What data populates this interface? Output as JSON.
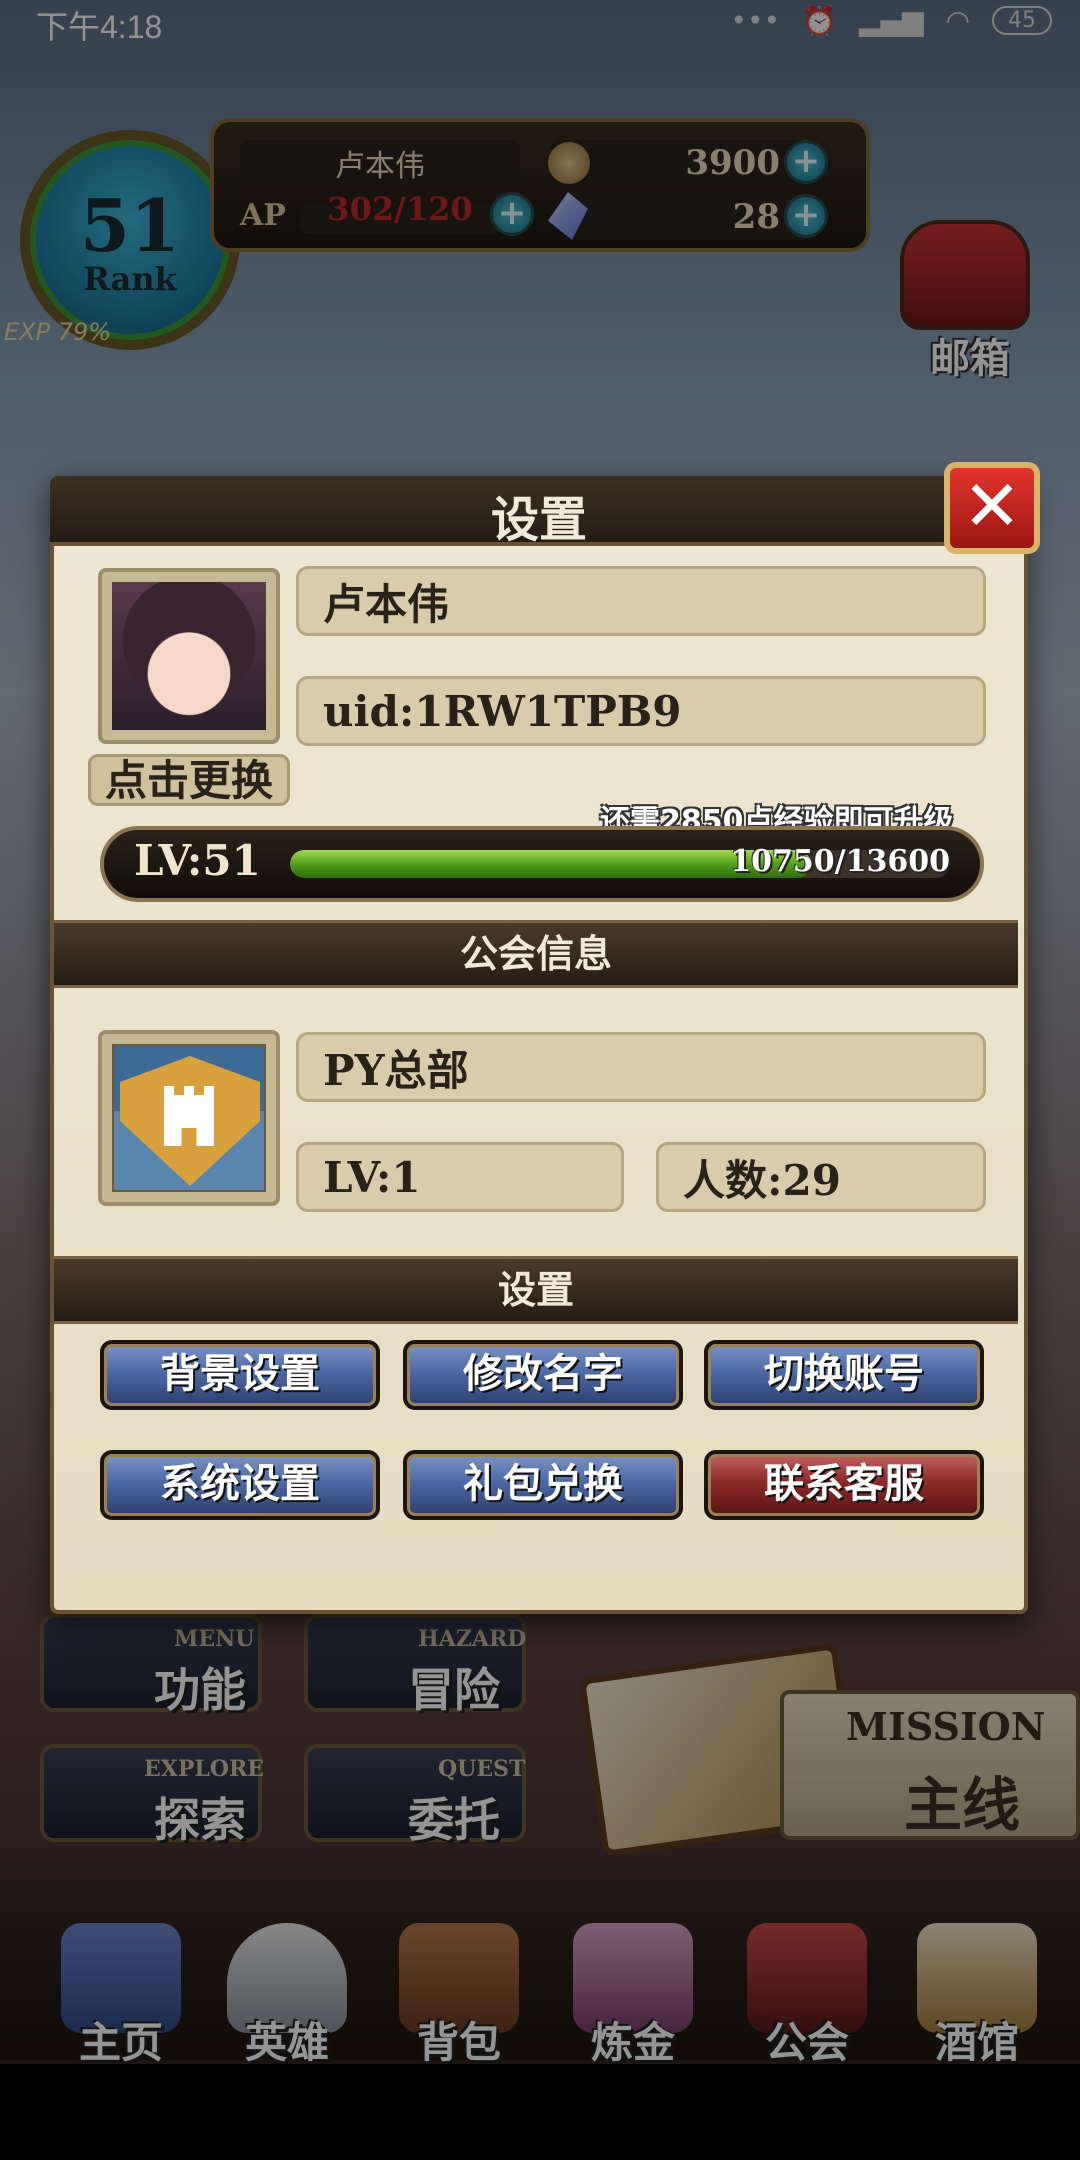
{
  "status_bar": {
    "time": "下午4:18",
    "battery": "45"
  },
  "hud": {
    "rank": "51",
    "rank_label": "Rank",
    "exp": "EXP 79%",
    "player_name": "卢本伟",
    "ap_label": "AP",
    "ap_value": "302/120",
    "gold": "3900",
    "gems": "28",
    "mailbox_label": "邮箱"
  },
  "background_menu": {
    "menu_sub": "MENU",
    "menu_main": "功能",
    "hazard_sub": "HAZARD",
    "hazard_main": "冒险",
    "explore_sub": "EXPLORE",
    "explore_main": "探索",
    "quest_sub": "QUEST",
    "quest_main": "委托",
    "mission_sub": "MISSION",
    "mission_main": "主线"
  },
  "nav": [
    {
      "label": "主页"
    },
    {
      "label": "英雄"
    },
    {
      "label": "背包"
    },
    {
      "label": "炼金"
    },
    {
      "label": "公会"
    },
    {
      "label": "酒馆"
    }
  ],
  "modal": {
    "title": "设置",
    "close_symbol": "✕",
    "profile": {
      "name": "卢本伟",
      "uid": "uid:1RW1TPB9",
      "change_avatar": "点击更换",
      "exp_hint": "还需2850点经验即可升级",
      "level": "LV:51",
      "exp_text": "10750/13600",
      "exp_fraction": 0.79
    },
    "guild_section_title": "公会信息",
    "guild": {
      "name": "PY总部",
      "level": "LV:1",
      "members": "人数:29"
    },
    "settings_section_title": "设置",
    "buttons": [
      {
        "label": "背景设置",
        "style": "blue"
      },
      {
        "label": "修改名字",
        "style": "blue"
      },
      {
        "label": "切换账号",
        "style": "blue"
      },
      {
        "label": "系统设置",
        "style": "blue"
      },
      {
        "label": "礼包兑换",
        "style": "blue"
      },
      {
        "label": "联系客服",
        "style": "red"
      }
    ]
  }
}
